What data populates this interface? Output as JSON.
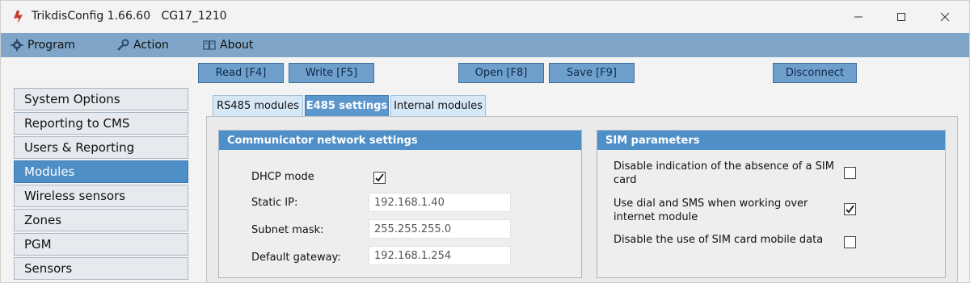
{
  "window": {
    "title": "TrikdisConfig 1.66.60",
    "device": "CG17_1210",
    "controls": {
      "minimize": "—",
      "maximize": "☐",
      "close": "✕"
    }
  },
  "menu": {
    "program": "Program",
    "action": "Action",
    "about": "About"
  },
  "toolbar": {
    "read": "Read [F4]",
    "write": "Write [F5]",
    "open": "Open [F8]",
    "save": "Save [F9]",
    "disconnect": "Disconnect"
  },
  "sidebar": {
    "items": [
      {
        "label": "System Options",
        "active": false
      },
      {
        "label": "Reporting to CMS",
        "active": false
      },
      {
        "label": "Users & Reporting",
        "active": false
      },
      {
        "label": "Modules",
        "active": true
      },
      {
        "label": "Wireless sensors",
        "active": false
      },
      {
        "label": "Zones",
        "active": false
      },
      {
        "label": "PGM",
        "active": false
      },
      {
        "label": "Sensors",
        "active": false
      }
    ]
  },
  "tabs": [
    {
      "label": "RS485 modules",
      "active": false
    },
    {
      "label": "E485 settings",
      "active": true
    },
    {
      "label": "Internal modules",
      "active": false
    }
  ],
  "network": {
    "title": "Communicator network settings",
    "dhcp_label": "DHCP mode",
    "dhcp_checked": true,
    "static_ip_label": "Static IP:",
    "static_ip": "192.168.1.40",
    "subnet_label": "Subnet mask:",
    "subnet": "255.255.255.0",
    "gateway_label": "Default gateway:",
    "gateway": "192.168.1.254"
  },
  "sim": {
    "title": "SIM parameters",
    "opt1_line1": "Disable indication of the absence of a SIM",
    "opt1_line2": "card",
    "opt1_checked": false,
    "opt2_line1": "Use dial and SMS when working over",
    "opt2_line2": "internet module",
    "opt2_checked": true,
    "opt3": "Disable the use of SIM card mobile data",
    "opt3_checked": false
  },
  "colors": {
    "menu_bar": "#7fa6c8",
    "accent": "#4f8fc7",
    "button": "#6f9fcb",
    "app_icon": "#c0392b"
  },
  "icons": {
    "app": "trikdis-app-icon",
    "program": "gear-icon",
    "action": "wrench-icon",
    "about": "book-icon"
  }
}
